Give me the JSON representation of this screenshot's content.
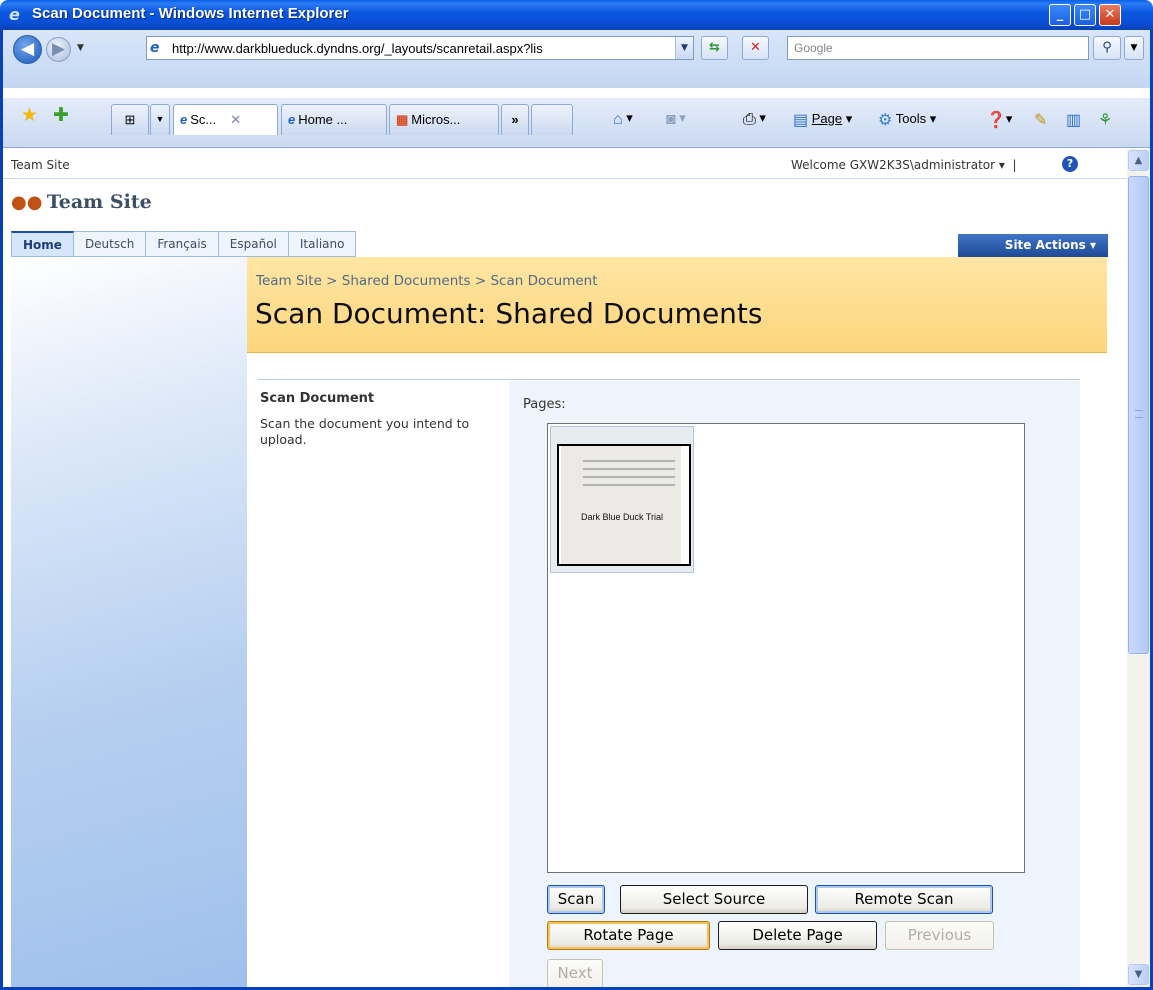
{
  "window": {
    "title": "Scan Document - Windows Internet Explorer"
  },
  "addressbar": {
    "url": "http://www.darkblueduck.dyndns.org/_layouts/scanretail.aspx?lis",
    "search_placeholder": "Google"
  },
  "tabs": [
    {
      "label": "Sc...",
      "active": true
    },
    {
      "label": "Home ...",
      "active": false
    },
    {
      "label": "Micros...",
      "active": false
    }
  ],
  "tabs_more": "»",
  "commands": {
    "page": "Page",
    "tools": "Tools"
  },
  "sharepoint": {
    "site_crumb": "Team Site",
    "welcome": "Welcome GXW2K3S\\administrator",
    "site_title": "Team Site",
    "nav_tabs": [
      "Home",
      "Deutsch",
      "Français",
      "Español",
      "Italiano"
    ],
    "site_actions": "Site Actions"
  },
  "header": {
    "breadcrumb": "Team Site > Shared Documents > Scan Document",
    "title": "Scan Document: Shared Documents"
  },
  "section": {
    "title": "Scan Document",
    "description": "Scan the document you intend to upload.",
    "pages_label": "Pages:"
  },
  "thumbnail": {
    "doc_title": "Dark Blue Duck Trial"
  },
  "buttons": {
    "scan": "Scan",
    "select_source": "Select Source",
    "remote_scan": "Remote Scan",
    "rotate_page": "Rotate Page",
    "delete_page": "Delete Page",
    "previous": "Previous",
    "next": "Next"
  }
}
